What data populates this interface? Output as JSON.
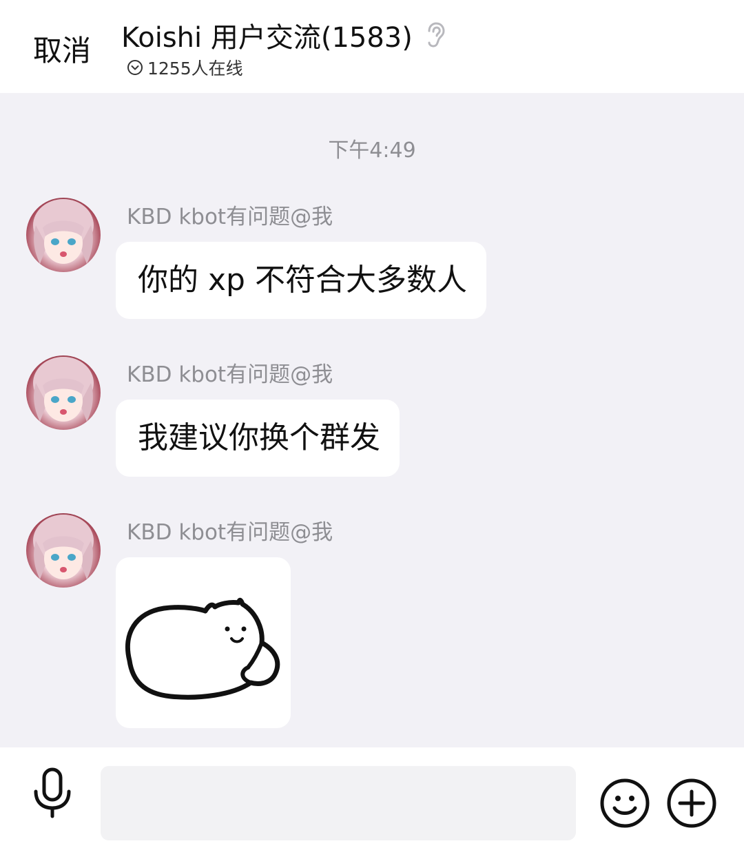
{
  "header": {
    "cancel_label": "取消",
    "title": "Koishi 用户交流(1583)",
    "online_text": "1255人在线"
  },
  "chat": {
    "timestamp": "下午4:49",
    "messages": [
      {
        "sender": "KBD kbot有问题@我",
        "text": "你的 xp 不符合大多数人",
        "type": "text"
      },
      {
        "sender": "KBD kbot有问题@我",
        "text": "我建议你换个群发",
        "type": "text"
      },
      {
        "sender": "KBD kbot有问题@我",
        "type": "sticker",
        "sticker_icon": "lying-cat-sticker"
      }
    ]
  },
  "input_bar": {
    "value": "",
    "placeholder": ""
  },
  "colors": {
    "chat_background": "#f2f1f6",
    "bubble": "#ffffff",
    "secondary_text": "#8e8e93"
  },
  "icons": {
    "ear": "ear-icon",
    "online_chevron": "chevron-down-circle-icon",
    "mic": "microphone-icon",
    "emoji": "smiley-icon",
    "plus": "plus-circle-icon"
  }
}
